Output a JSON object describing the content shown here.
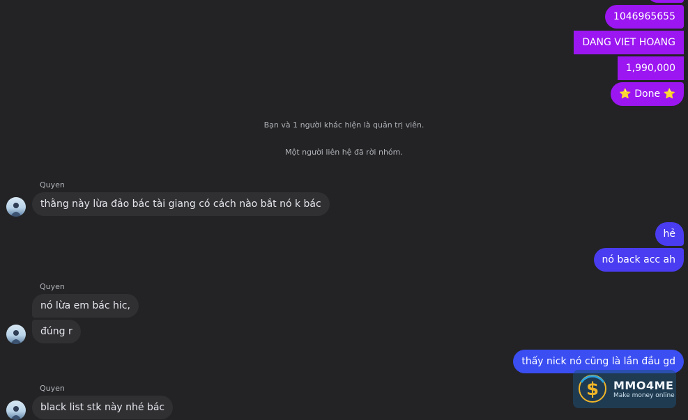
{
  "outgoing_top": {
    "number": "1046965655",
    "name": "DANG VIET HOANG",
    "amount": "1,990,000",
    "done": "⭐ Done ⭐"
  },
  "system": {
    "admin": "Bạn và 1 người khác hiện là quản trị viên.",
    "left": "Một người liên hệ đã rời nhóm."
  },
  "group1": {
    "sender": "Quyen",
    "msg": "thằng này lừa đảo bác tài giang có cách nào bắt nó k bác"
  },
  "outgoing_mid": {
    "msg1": "hẻ",
    "msg2": "nó back acc ah"
  },
  "group2": {
    "sender": "Quyen",
    "msg1": "nó lừa em bác hic,",
    "msg2": "đúng r"
  },
  "outgoing_bottom": {
    "msg": "thấy nick nó cũng là lần đầu gd"
  },
  "group3": {
    "sender": "Quyen",
    "msg": "black list stk này nhé bác"
  },
  "watermark": {
    "brand": "MMO4ME",
    "tagline": "Make money online"
  },
  "colors": {
    "purple_bubble": "#9b16f0",
    "blue_bubble": "#4a3cf0",
    "incoming_bubble": "#303033",
    "background": "#232325"
  }
}
